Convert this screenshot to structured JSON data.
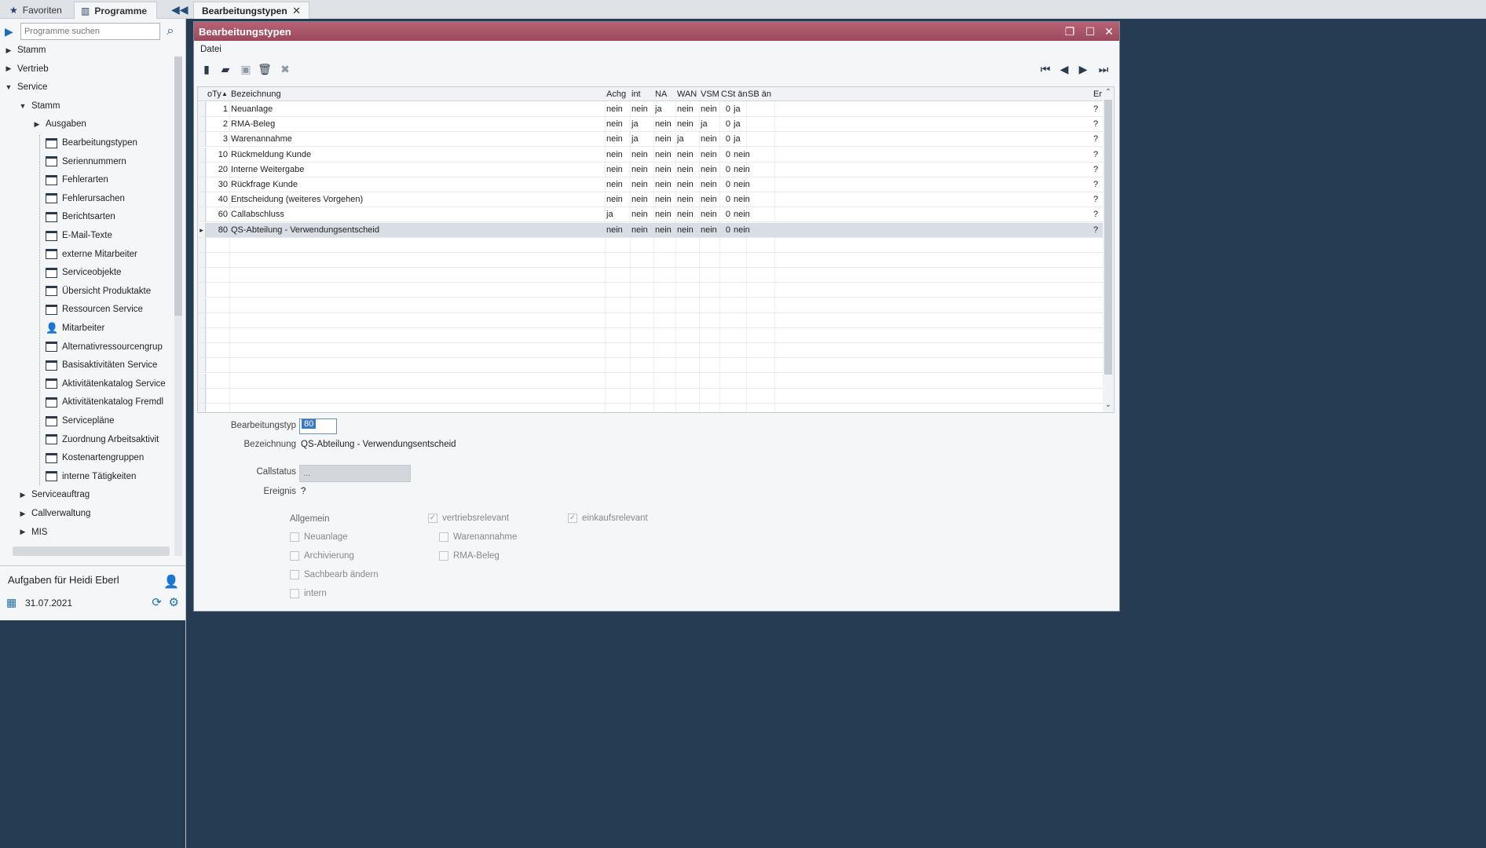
{
  "topbar": {
    "tabs": [
      {
        "label": "Favoriten",
        "icon": "star-icon"
      },
      {
        "label": "Programme",
        "icon": "programs-icon",
        "active": true
      }
    ],
    "document_tab": {
      "label": "Bearbeitungstypen"
    }
  },
  "sidebar": {
    "search": {
      "placeholder": "Programme suchen"
    },
    "tree": [
      {
        "label": "Stamm",
        "level": 0,
        "kind": "folder",
        "expanded": false
      },
      {
        "label": "Vertrieb",
        "level": 0,
        "kind": "folder",
        "expanded": false
      },
      {
        "label": "Service",
        "level": 0,
        "kind": "folder",
        "expanded": true
      },
      {
        "label": "Stamm",
        "level": 1,
        "kind": "folder",
        "expanded": true
      },
      {
        "label": "Ausgaben",
        "level": 2,
        "kind": "folder",
        "expanded": false
      },
      {
        "label": "Bearbeitungstypen",
        "level": 2,
        "kind": "page"
      },
      {
        "label": "Seriennummern",
        "level": 2,
        "kind": "page"
      },
      {
        "label": "Fehlerarten",
        "level": 2,
        "kind": "page"
      },
      {
        "label": "Fehlerursachen",
        "level": 2,
        "kind": "page"
      },
      {
        "label": "Berichtsarten",
        "level": 2,
        "kind": "page"
      },
      {
        "label": "E-Mail-Texte",
        "level": 2,
        "kind": "page"
      },
      {
        "label": "externe Mitarbeiter",
        "level": 2,
        "kind": "page"
      },
      {
        "label": "Serviceobjekte",
        "level": 2,
        "kind": "page"
      },
      {
        "label": "Übersicht Produktakte",
        "level": 2,
        "kind": "page"
      },
      {
        "label": "Ressourcen Service",
        "level": 2,
        "kind": "page"
      },
      {
        "label": "Mitarbeiter",
        "level": 2,
        "kind": "person"
      },
      {
        "label": "Alternativressourcengrup",
        "level": 2,
        "kind": "page"
      },
      {
        "label": "Basisaktivitäten Service",
        "level": 2,
        "kind": "page"
      },
      {
        "label": "Aktivitätenkatalog Service",
        "level": 2,
        "kind": "page"
      },
      {
        "label": "Aktivitätenkatalog Fremdl",
        "level": 2,
        "kind": "page"
      },
      {
        "label": "Servicepläne",
        "level": 2,
        "kind": "page"
      },
      {
        "label": "Zuordnung Arbeitsaktivit",
        "level": 2,
        "kind": "page"
      },
      {
        "label": "Kostenartengruppen",
        "level": 2,
        "kind": "page"
      },
      {
        "label": "interne Tätigkeiten",
        "level": 2,
        "kind": "page"
      },
      {
        "label": "Serviceauftrag",
        "level": 1,
        "kind": "folder",
        "expanded": false
      },
      {
        "label": "Callverwaltung",
        "level": 1,
        "kind": "folder",
        "expanded": false
      },
      {
        "label": "MIS",
        "level": 1,
        "kind": "folder",
        "expanded": false
      }
    ],
    "tasks": {
      "title": "Aufgaben für Heidi Eberl",
      "date": "31.07.2021"
    }
  },
  "window": {
    "title": "Bearbeitungstypen",
    "menu": "Datei",
    "toolbar": [
      {
        "name": "new-icon"
      },
      {
        "name": "open-folder-icon"
      },
      {
        "name": "save-icon"
      },
      {
        "name": "delete-icon"
      },
      {
        "name": "cancel-icon"
      }
    ],
    "grid": {
      "columns": [
        "oTy",
        "Bezeichnung",
        "Achg",
        "int",
        "NA",
        "WAN",
        "VSM",
        "CSt än",
        "SB än",
        "Er"
      ],
      "rows": [
        [
          "1",
          "Neuanlage",
          "nein",
          "nein",
          "ja",
          "nein",
          "nein",
          "0",
          "ja",
          "?"
        ],
        [
          "2",
          "RMA-Beleg",
          "nein",
          "ja",
          "nein",
          "nein",
          "ja",
          "0",
          "ja",
          "?"
        ],
        [
          "3",
          "Warenannahme",
          "nein",
          "ja",
          "nein",
          "ja",
          "nein",
          "0",
          "ja",
          "?"
        ],
        [
          "10",
          "Rückmeldung Kunde",
          "nein",
          "nein",
          "nein",
          "nein",
          "nein",
          "0",
          "nein",
          "?"
        ],
        [
          "20",
          "Interne Weitergabe",
          "nein",
          "nein",
          "nein",
          "nein",
          "nein",
          "0",
          "nein",
          "?"
        ],
        [
          "30",
          "Rückfrage Kunde",
          "nein",
          "nein",
          "nein",
          "nein",
          "nein",
          "0",
          "nein",
          "?"
        ],
        [
          "40",
          "Entscheidung (weiteres Vorgehen)",
          "nein",
          "nein",
          "nein",
          "nein",
          "nein",
          "0",
          "nein",
          "?"
        ],
        [
          "60",
          "Callabschluss",
          "ja",
          "nein",
          "nein",
          "nein",
          "nein",
          "0",
          "nein",
          "?"
        ],
        [
          "80",
          "QS-Abteilung - Verwendungsentscheid",
          "nein",
          "nein",
          "nein",
          "nein",
          "nein",
          "0",
          "nein",
          "?"
        ]
      ],
      "selected_row": 8
    },
    "form": {
      "typ_label": "Bearbeitungstyp",
      "typ_value": "80",
      "bez_label": "Bezeichnung",
      "bez_value": "QS-Abteilung - Verwendungsentscheid",
      "callstatus_label": "Callstatus",
      "callstatus_value": "...",
      "ereignis_label": "Ereignis",
      "ereignis_value": "?",
      "allgemein_label": "Allgemein",
      "checks": {
        "vertriebsrelevant": "vertriebsrelevant",
        "einkaufsrelevant": "einkaufsrelevant",
        "neuanlage": "Neuanlage",
        "warenannahme": "Warenannahme",
        "archivierung": "Archivierung",
        "rma_beleg": "RMA-Beleg",
        "sachbearb": "Sachbearb ändern",
        "intern": "intern"
      }
    }
  }
}
